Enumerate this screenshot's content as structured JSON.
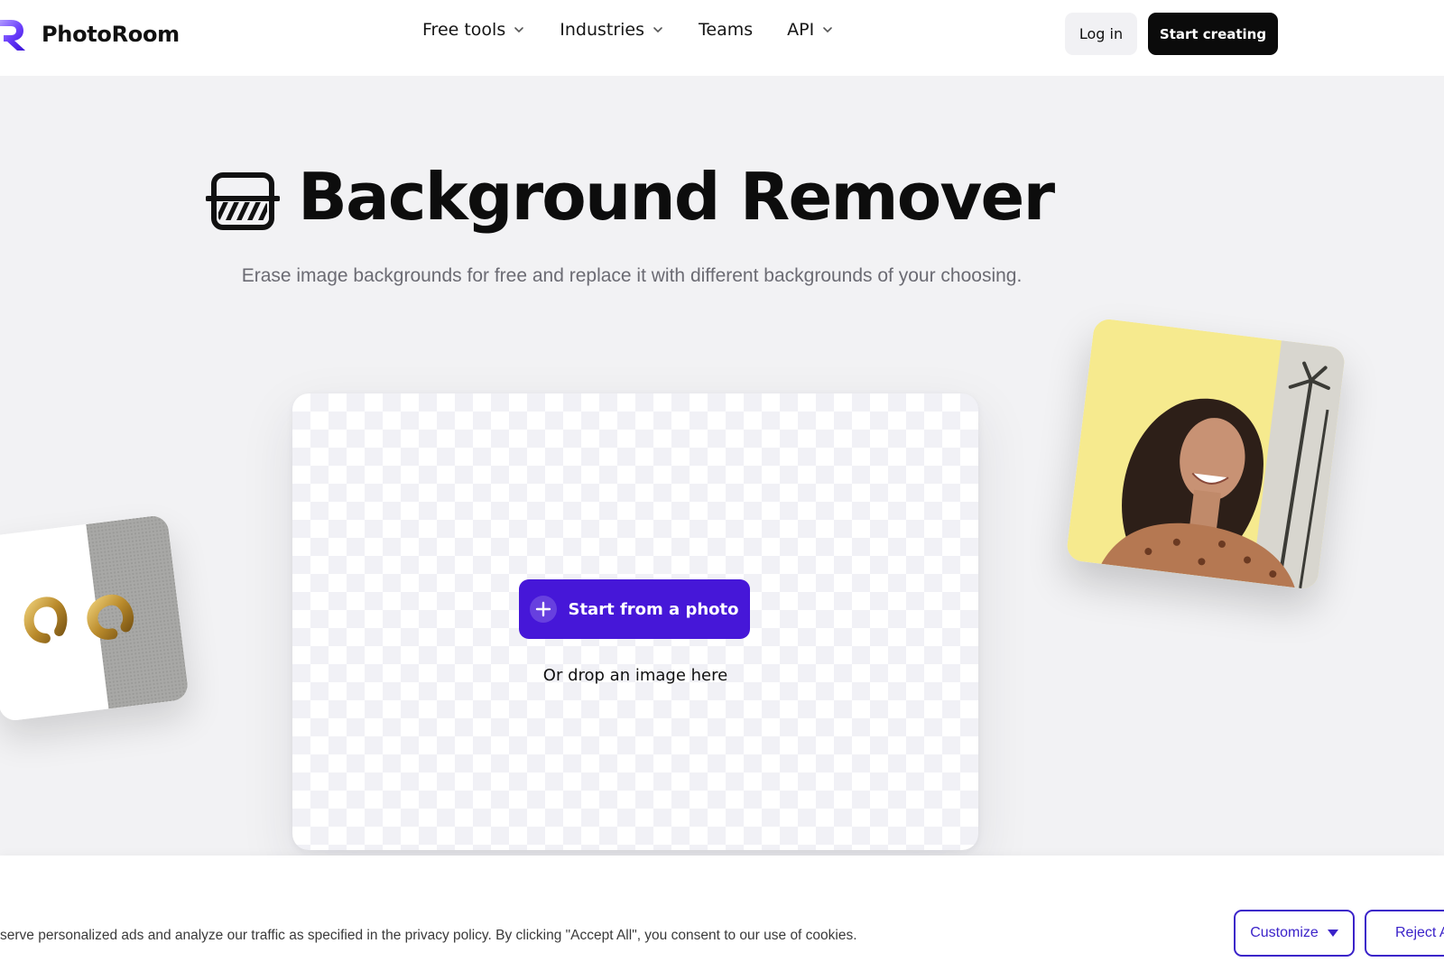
{
  "header": {
    "brand": "PhotoRoom",
    "nav": [
      {
        "label": "Free tools",
        "has_dropdown": true
      },
      {
        "label": "Industries",
        "has_dropdown": true
      },
      {
        "label": "Teams",
        "has_dropdown": false
      },
      {
        "label": "API",
        "has_dropdown": true
      }
    ],
    "login_label": "Log in",
    "start_label": "Start creating"
  },
  "hero": {
    "icon": "background-remover-icon",
    "title": "Background Remover",
    "subtitle": "Erase image backgrounds for free and replace it with different backgrounds of your choosing."
  },
  "upload": {
    "button_label": "Start from a photo",
    "button_icon": "plus-icon",
    "drop_hint": "Or drop an image here"
  },
  "cookie": {
    "text": "serve personalized ads and analyze our traffic as specified in the privacy policy. By clicking \"Accept All\", you consent to our use of cookies.",
    "customize_label": "Customize",
    "reject_label": "Reject A"
  },
  "colors": {
    "accent": "#4617d8",
    "dark_button": "#0b0b0b",
    "cookie_border": "#3b23c9",
    "page_bg": "#f2f2f4"
  }
}
